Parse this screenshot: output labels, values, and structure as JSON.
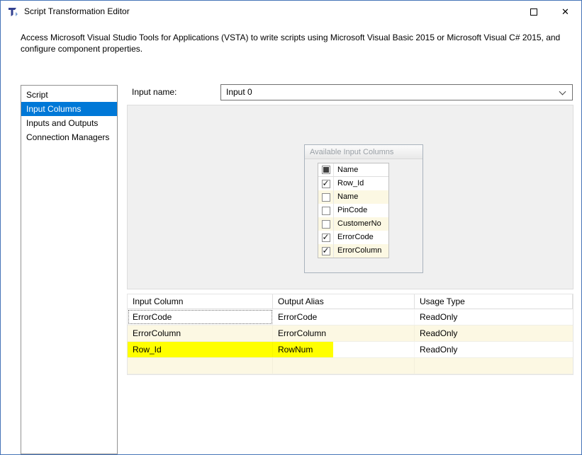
{
  "window": {
    "title": "Script Transformation Editor",
    "description": "Access Microsoft Visual Studio Tools for Applications (VSTA) to write scripts using Microsoft Visual Basic 2015 or Microsoft Visual C# 2015, and configure component properties.",
    "controls": {
      "maximize_icon": "square-outline",
      "close_glyph": "✕"
    }
  },
  "sidebar": {
    "items": [
      {
        "label": "Script",
        "selected": false
      },
      {
        "label": "Input Columns",
        "selected": true
      },
      {
        "label": "Inputs and Outputs",
        "selected": false
      },
      {
        "label": "Connection Managers",
        "selected": false
      }
    ]
  },
  "input_name": {
    "label": "Input name:",
    "value": "Input 0"
  },
  "available_columns": {
    "title": "Available Input Columns",
    "name_header": "Name",
    "select_all_state": "filled",
    "rows": [
      {
        "name": "Row_Id",
        "checked": true
      },
      {
        "name": "Name",
        "checked": false
      },
      {
        "name": "PinCode",
        "checked": false
      },
      {
        "name": "CustomerNo",
        "checked": false
      },
      {
        "name": "ErrorCode",
        "checked": true
      },
      {
        "name": "ErrorColumn",
        "checked": true
      }
    ]
  },
  "columns_grid": {
    "headers": [
      "Input Column",
      "Output Alias",
      "Usage Type"
    ],
    "rows": [
      {
        "input_column": "ErrorCode",
        "output_alias": "ErrorCode",
        "usage_type": "ReadOnly",
        "marker_highlight": false
      },
      {
        "input_column": "ErrorColumn",
        "output_alias": "ErrorColumn",
        "usage_type": "ReadOnly",
        "marker_highlight": false
      },
      {
        "input_column": "Row_Id",
        "output_alias": "RowNum",
        "usage_type": "ReadOnly",
        "marker_highlight": true
      },
      {
        "input_column": "",
        "output_alias": "",
        "usage_type": "",
        "marker_highlight": false
      }
    ]
  },
  "colors": {
    "selection_blue": "#0078d7",
    "alt_row_cream": "#fcf8e3",
    "marker_yellow": "#ffff00",
    "window_border": "#4674b8"
  }
}
